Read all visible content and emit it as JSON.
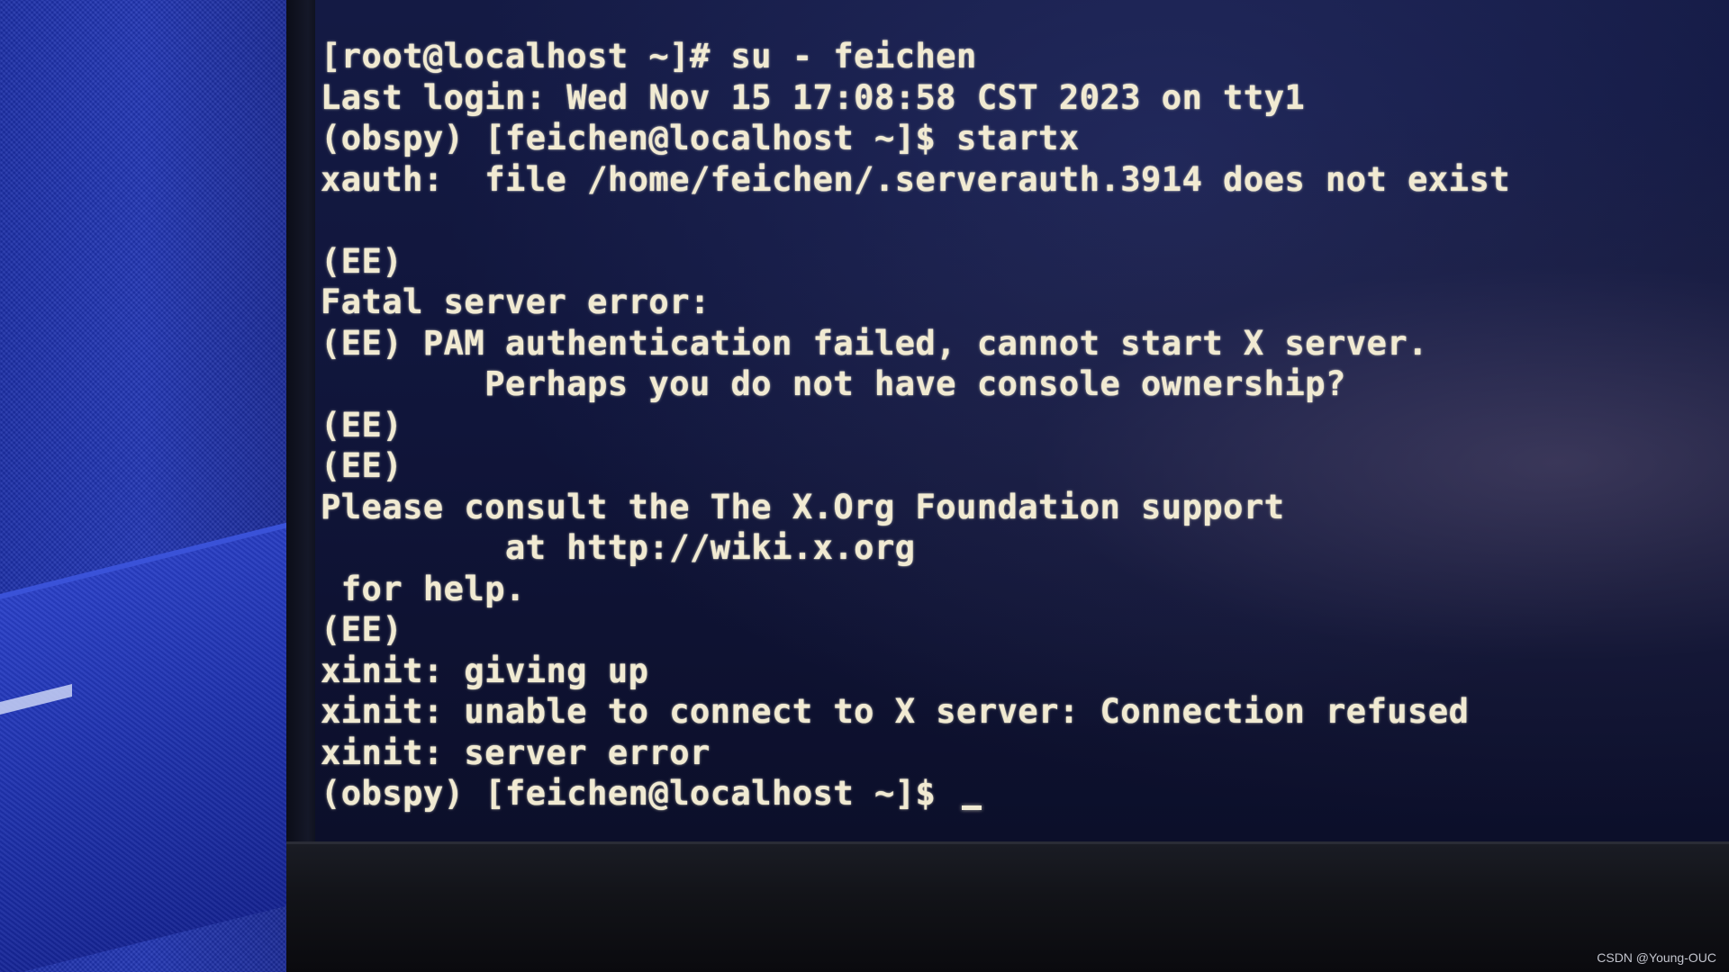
{
  "terminal": {
    "lines": [
      "[root@localhost ~]# su - feichen",
      "Last login: Wed Nov 15 17:08:58 CST 2023 on tty1",
      "(obspy) [feichen@localhost ~]$ startx",
      "xauth:  file /home/feichen/.serverauth.3914 does not exist",
      "",
      "(EE)",
      "Fatal server error:",
      "(EE) PAM authentication failed, cannot start X server.",
      "        Perhaps you do not have console ownership?",
      "(EE)",
      "(EE)",
      "Please consult the The X.Org Foundation support",
      "         at http://wiki.x.org",
      " for help.",
      "(EE)",
      "xinit: giving up",
      "xinit: unable to connect to X server: Connection refused",
      "xinit: server error",
      "(obspy) [feichen@localhost ~]$ "
    ]
  },
  "watermark": "CSDN @Young-OUC"
}
